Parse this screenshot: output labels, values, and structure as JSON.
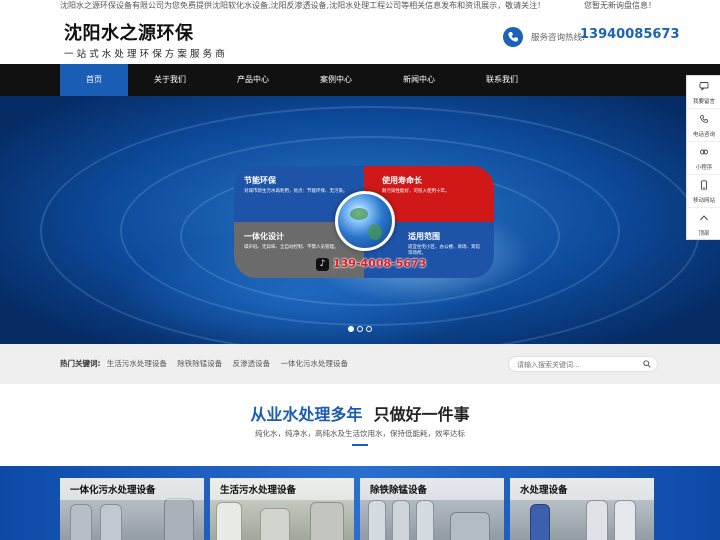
{
  "topbar": {
    "notice": "沈阳水之源环保设备有限公司为您免费提供沈阳软化水设备,沈阳反渗透设备,沈阳水处理工程公司等相关信息发布和资讯展示，敬请关注！",
    "right": "您暂无新询盘信息！"
  },
  "header": {
    "brand": "沈阳水之源环保",
    "slogan": "一站式水处理环保方案服务商",
    "hotline_label": "服务咨询热线:",
    "hotline_number": "13940085673"
  },
  "nav": {
    "items": [
      "首页",
      "关于我们",
      "产品中心",
      "案例中心",
      "新闻中心",
      "联系我们"
    ],
    "active_index": 0
  },
  "banner": {
    "panels": [
      {
        "title": "节能环保",
        "desc": "对城市新生污水再利用，优点：节能环保、无污染。"
      },
      {
        "title": "使用寿命长",
        "desc": "耐污染性能好，可投入使用十年。"
      },
      {
        "title": "一体化设计",
        "desc": "噪声低、无异味、全自动控制、不需人员管理。"
      },
      {
        "title": "适用范围",
        "desc": "适宜住宅小区、办公楼、商场、宾馆等场所。"
      }
    ],
    "hotline": "139-4008-5673",
    "slide_count": 3,
    "active_slide": 0
  },
  "search": {
    "hot_label": "热门关键词:",
    "keywords": [
      "生活污水处理设备",
      "除铁除锰设备",
      "反渗透设备",
      "一体化污水处理设备"
    ],
    "placeholder": "请输入搜索关键词..."
  },
  "intro": {
    "title_blue": "从业水处理多年",
    "title_dark": "只做好一件事",
    "subtitle": "纯化水，纯净水，高纯水及生活饮用水，保持低能耗，效率达标"
  },
  "products": [
    {
      "label": "一体化污水处理设备"
    },
    {
      "label": "生活污水处理设备"
    },
    {
      "label": "除铁除锰设备"
    },
    {
      "label": "水处理设备"
    }
  ],
  "side_toolbar": [
    {
      "label": "我要留言",
      "icon": "message-icon"
    },
    {
      "label": "电话咨询",
      "icon": "phone-icon"
    },
    {
      "label": "小程序",
      "icon": "mini-program-icon"
    },
    {
      "label": "移动网站",
      "icon": "mobile-icon"
    },
    {
      "label": "顶部",
      "icon": "arrow-up-icon"
    }
  ],
  "colors": {
    "accent": "#1a5db5",
    "nav_bg": "#111111",
    "red": "#d01818"
  }
}
